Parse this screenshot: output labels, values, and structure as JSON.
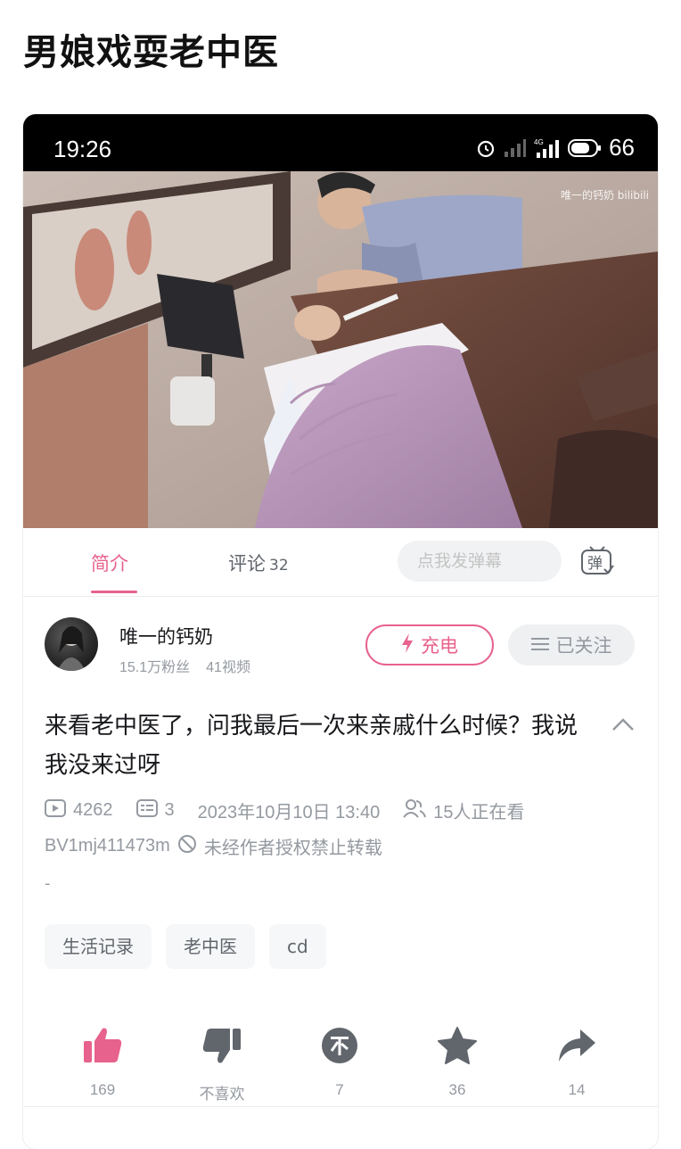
{
  "page_title": "男娘戏耍老中医",
  "status_bar": {
    "time": "19:26",
    "network": "4G",
    "battery": "66"
  },
  "video": {
    "watermark": "唯一的钙奶 bilibili"
  },
  "tabs": {
    "intro_label": "简介",
    "comments_label": "评论",
    "comments_count": "32",
    "danmaku_placeholder": "点我发弹幕",
    "danmaku_icon_text": "弹"
  },
  "uploader": {
    "name": "唯一的钙奶",
    "fans": "15.1万粉丝",
    "videos": "41视频",
    "charge_label": "充电",
    "follow_label": "已关注"
  },
  "description": {
    "text": "来看老中医了，问我最后一次来亲戚什么时候？我说我没来过呀",
    "views": "4262",
    "danmaku_count": "3",
    "publish_time": "2023年10月10日 13:40",
    "watching": "15人正在看",
    "bvid": "BV1mj411473m",
    "copyright_notice": "未经作者授权禁止转载",
    "extra": "-"
  },
  "tags": [
    "生活记录",
    "老中医",
    "cd"
  ],
  "actions": {
    "like": "169",
    "dislike": "不喜欢",
    "coin": "7",
    "favorite": "36",
    "share": "14"
  },
  "colors": {
    "accent": "#e7628c",
    "muted": "#9499a0"
  }
}
